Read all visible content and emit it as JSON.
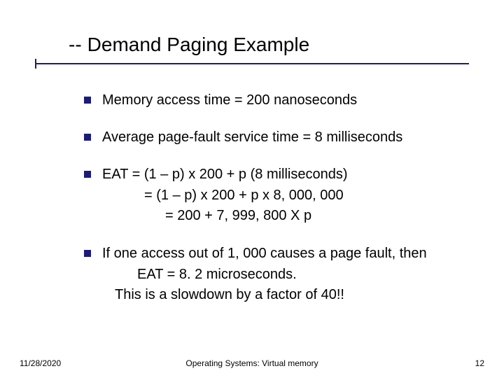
{
  "title": {
    "dashes": "--",
    "text": "Demand Paging Example"
  },
  "bullets": {
    "b1": "Memory access time = 200 nanoseconds",
    "b2": "Average page-fault service time = 8 milliseconds",
    "b3": {
      "l1": "EAT = (1 – p) x 200 + p (8 milliseconds)",
      "l2": "= (1 – p)  x 200 + p x 8, 000, 000",
      "l3": "= 200 + 7, 999, 800 X p"
    },
    "b4": {
      "l1": "If one access out of 1, 000 causes a page fault, then",
      "l2": "EAT = 8. 2 microseconds.",
      "l3": "This is a slowdown by a factor of 40!!"
    }
  },
  "footer": {
    "date": "11/28/2020",
    "center": "Operating Systems: Virtual memory",
    "page": "12"
  }
}
